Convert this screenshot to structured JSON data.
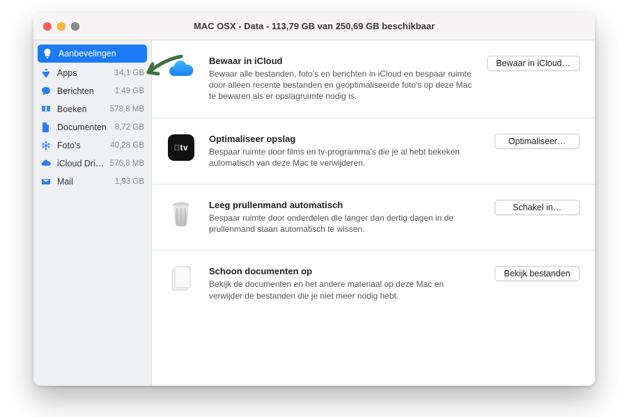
{
  "window": {
    "title": "MAC OSX - Data - 113,79 GB van 250,69 GB beschikbaar"
  },
  "sidebar": {
    "items": [
      {
        "label": "Aanbevelingen",
        "value": ""
      },
      {
        "label": "Apps",
        "value": "14,1 GB"
      },
      {
        "label": "Berichten",
        "value": "1,49 GB"
      },
      {
        "label": "Boeken",
        "value": "578,8 MB"
      },
      {
        "label": "Documenten",
        "value": "8,72 GB"
      },
      {
        "label": "Foto's",
        "value": "40,28 GB"
      },
      {
        "label": "iCloud Drive",
        "value": "576,8 MB"
      },
      {
        "label": "Mail",
        "value": "1,93 GB"
      }
    ]
  },
  "main": {
    "sections": [
      {
        "title": "Bewaar in iCloud",
        "desc": "Bewaar alle bestanden, foto's en berichten in iCloud en bespaar ruimte door alleen recente bestanden en geoptimaliseerde foto's op deze Mac te bewaren als er opslagruimte nodig is.",
        "button": "Bewaar in iCloud…"
      },
      {
        "title": "Optimaliseer opslag",
        "desc": "Bespaar ruimte door films en tv-programma's die je al hebt bekeken automatisch van deze Mac te verwijderen.",
        "button": "Optimaliseer…"
      },
      {
        "title": "Leeg prullenmand automatisch",
        "desc": "Bespaar ruimte door onderdelen die langer dan dertig dagen in de prullenmand staan automatisch te wissen.",
        "button": "Schakel in…"
      },
      {
        "title": "Schoon documenten op",
        "desc": "Bekijk de documenten en het andere materiaal op deze Mac en verwijder de bestanden die je niet meer nodig hebt.",
        "button": "Bekijk bestanden"
      }
    ]
  }
}
